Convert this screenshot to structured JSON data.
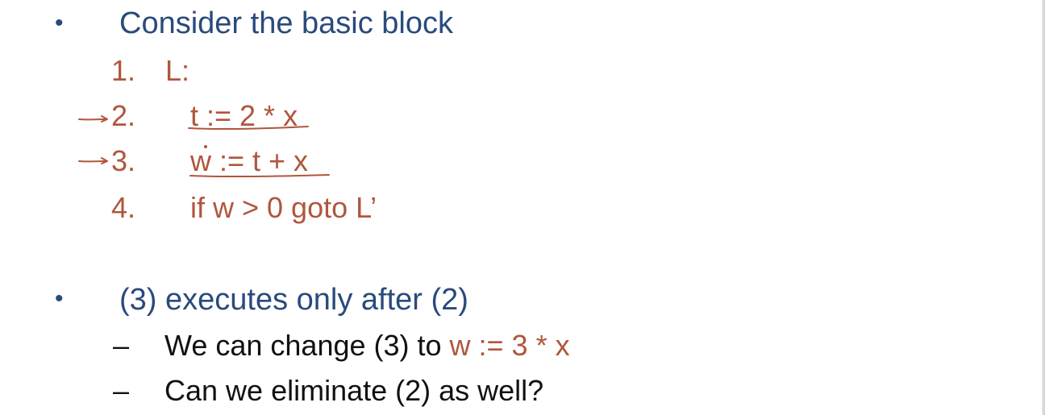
{
  "colors": {
    "primary_text": "#2a4a7c",
    "code_text": "#b0563d",
    "body_text": "#111111",
    "ink_annotation": "#b0563d"
  },
  "bullets": [
    {
      "marker": "•",
      "text": "Consider the basic block"
    },
    {
      "marker": "•",
      "text": "(3) executes only after (2)"
    }
  ],
  "code_block": [
    {
      "number": "1.",
      "code": "L:"
    },
    {
      "number": "2.",
      "code": "t := 2 * x"
    },
    {
      "number": "3.",
      "code": "w := t + x"
    },
    {
      "number": "4.",
      "code": "if w > 0 goto L’"
    }
  ],
  "sub_bullets": [
    {
      "marker": "–",
      "text": "We can change (3) to ",
      "code": "w := 3 * x"
    },
    {
      "marker": "–",
      "text": "Can we eliminate (2) as well?"
    }
  ],
  "annotations": {
    "arrow_icon": "hand-drawn-arrow-icon",
    "underline_icon": "hand-drawn-underline"
  }
}
